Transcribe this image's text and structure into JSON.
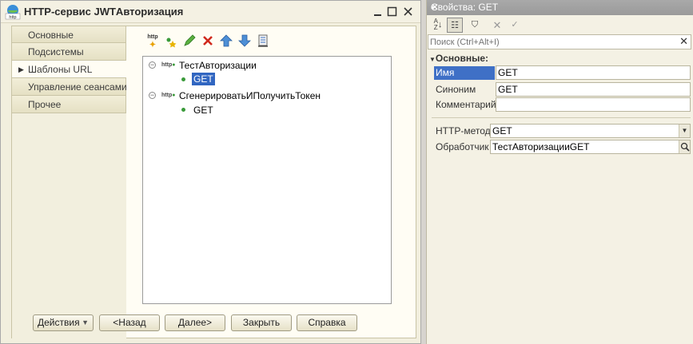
{
  "window": {
    "title": "HTTP-сервис JWTАвторизация",
    "icon": "http-service-icon",
    "controls": [
      "minimize",
      "maximize",
      "close"
    ]
  },
  "tabs": [
    {
      "label": "Основные",
      "active": false
    },
    {
      "label": "Подсистемы",
      "active": false
    },
    {
      "label": "Шаблоны URL",
      "active": true
    },
    {
      "label": "Управление сеансами",
      "active": false
    },
    {
      "label": "Прочее",
      "active": false
    }
  ],
  "toolbar": {
    "http_icon_text": "http",
    "icons": [
      "add-template-icon",
      "add-method-icon",
      "edit-icon",
      "delete-icon",
      "move-up-icon",
      "move-down-icon",
      "list-icon"
    ]
  },
  "tree": {
    "http_label": "http",
    "items": [
      {
        "label": "ТестАвторизации",
        "children": [
          {
            "label": "GET",
            "selected": true
          }
        ]
      },
      {
        "label": "СгенерироватьИПолучитьТокен",
        "children": [
          {
            "label": "GET",
            "selected": false
          }
        ]
      }
    ]
  },
  "buttons": {
    "actions": "Действия",
    "back": "<Назад",
    "next": "Далее>",
    "close": "Закрыть",
    "help": "Справка"
  },
  "properties": {
    "title": "Свойства: GET",
    "search_placeholder": "Поиск (Ctrl+Alt+I)",
    "group": "Основные:",
    "fields": {
      "name_label": "Имя",
      "name_value": "GET",
      "synonym_label": "Синоним",
      "synonym_value": "GET",
      "comment_label": "Комментарий",
      "comment_value": "",
      "method_label": "HTTP-метод",
      "method_value": "GET",
      "handler_label": "Обработчик",
      "handler_value": "ТестАвторизацииGET"
    }
  },
  "colors": {
    "selection": "#3166c1",
    "panel_title": "#9a9a9a",
    "window_bg": "#f2efde"
  }
}
